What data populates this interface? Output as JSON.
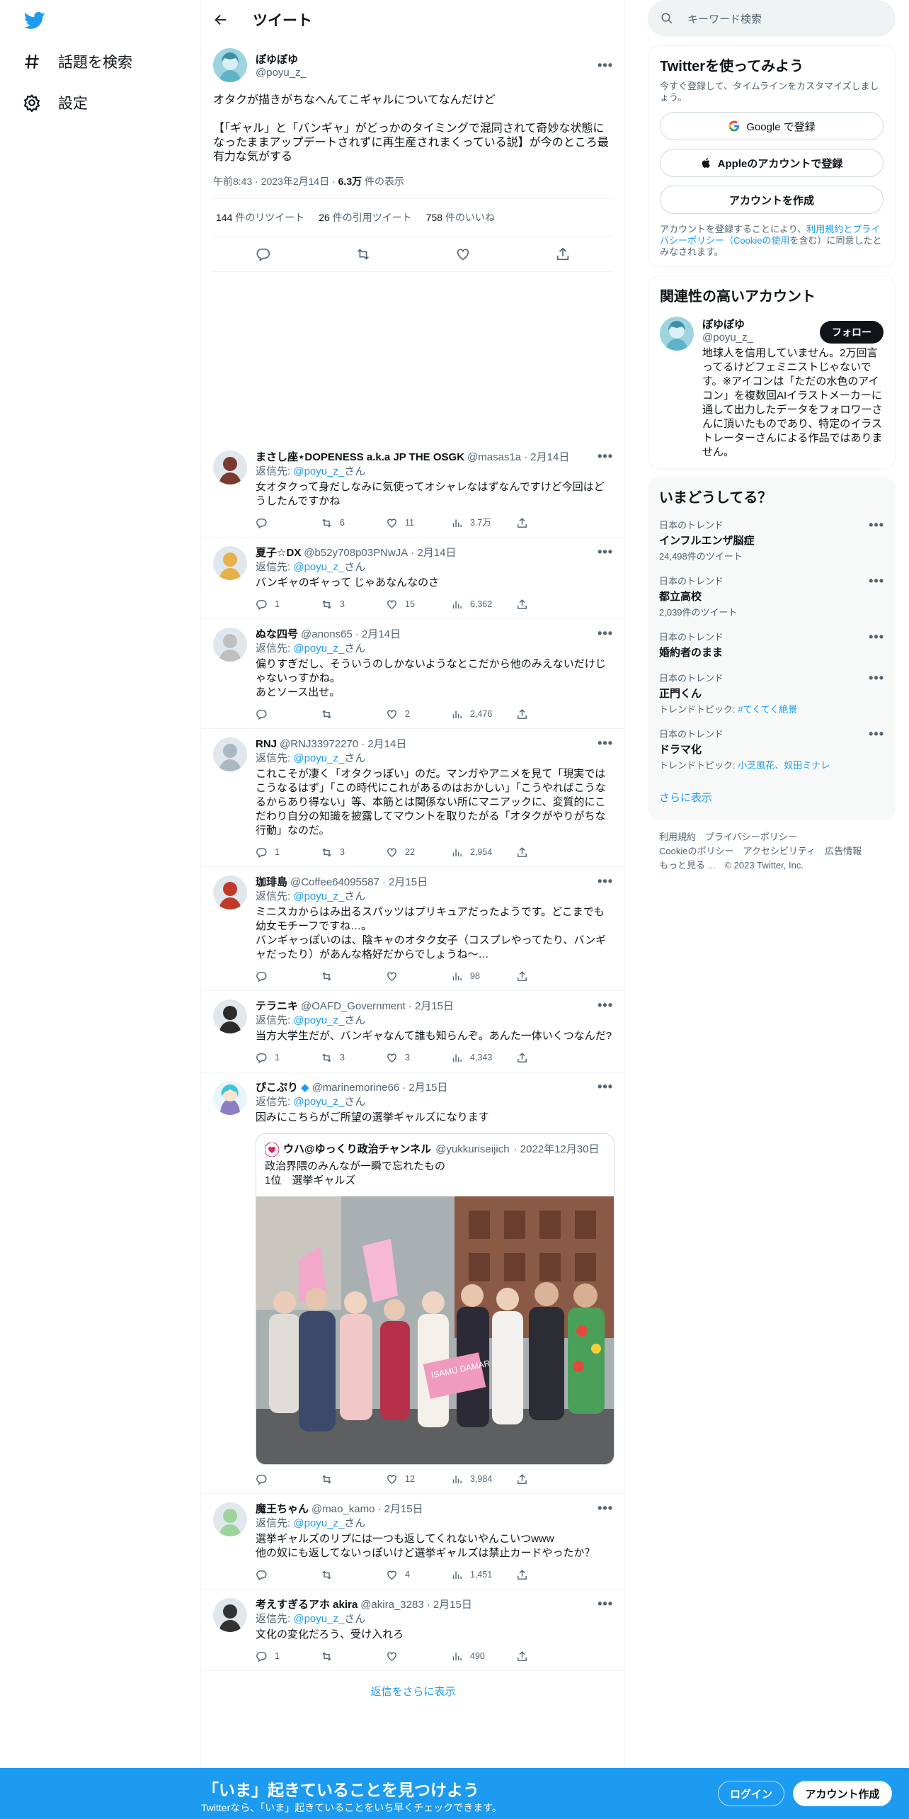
{
  "nav": {
    "explore": "話題を検索",
    "settings": "設定"
  },
  "header": {
    "title": "ツイート"
  },
  "tweet": {
    "name": "ぽゆぽゆ",
    "handle": "@poyu_z_",
    "text": "オタクが描きがちなへんてこギャルについてなんだけど\n\n【「ギャル」と「バンギャ」がどっかのタイミングで混同されて奇妙な状態になったままアップデートされずに再生産されまくっている説】が今のところ最有力な気がする",
    "time": "午前8:43 · 2023年2月14日 · ",
    "views_count": "6.3万",
    "views_label": " 件の表示",
    "retweets": "144",
    "retweets_label": " 件のリツイート",
    "quotes": "26",
    "quotes_label": " 件の引用ツイート",
    "likes": "758",
    "likes_label": " 件のいいね"
  },
  "replies": [
    {
      "name": "まさし座⋆DOPENESS a.k.a JP THE OSGK",
      "handle": "@masas1a",
      "date": "· 2月14日",
      "reply_to": "@poyu_z_",
      "text": "女オタクって身だしなみに気使ってオシャレなはずなんですけど今回はどうしたんですかね",
      "replies": "",
      "retweets": "6",
      "likes": "11",
      "views": "3.7万"
    },
    {
      "name": "夏子☆DX",
      "handle": "@b52y708p03PNwJA",
      "date": "· 2月14日",
      "reply_to": "@poyu_z_",
      "text": "バンギャのギャって じゃあなんなのさ",
      "replies": "1",
      "retweets": "3",
      "likes": "15",
      "views": "6,362"
    },
    {
      "name": "ぬな四号",
      "handle": "@anons65",
      "date": "· 2月14日",
      "reply_to": "@poyu_z_",
      "text": "偏りすぎだし、そういうのしかないようなとこだから他のみえないだけじゃないっすかね。\nあとソース出せ。",
      "replies": "",
      "retweets": "",
      "likes": "2",
      "views": "2,476"
    },
    {
      "name": "RNJ",
      "handle": "@RNJ33972270",
      "date": "· 2月14日",
      "reply_to": "@poyu_z_",
      "text": "これこそが凄く「オタクっぽい」のだ。マンガやアニメを見て「現実ではこうなるはず」「この時代にこれがあるのはおかしい」「こうやればこうなるからあり得ない」等、本筋とは関係ない所にマニアックに、変質的にこだわり自分の知識を披露してマウントを取りたがる「オタクがやりがちな行動」なのだ。",
      "replies": "1",
      "retweets": "3",
      "likes": "22",
      "views": "2,954"
    },
    {
      "name": "珈琲島",
      "handle": "@Coffee64095587",
      "date": "· 2月15日",
      "reply_to": "@poyu_z_",
      "text": "ミニスカからはみ出るスパッツはプリキュアだったようです。どこまでも幼女モチーフですね…。\nバンギャっぽいのは、陰キャのオタク女子（コスプレやってたり、バンギャだったり）があんな格好だからでしょうね〜…",
      "replies": "",
      "retweets": "",
      "likes": "",
      "views": "98"
    },
    {
      "name": "テラニキ",
      "handle": "@OAFD_Government",
      "date": "· 2月15日",
      "reply_to": "@poyu_z_",
      "text": "当方大学生だが、バンギャなんて誰も知らんぞ。あんた一体いくつなんだ?",
      "replies": "1",
      "retweets": "3",
      "likes": "3",
      "views": "4,343"
    }
  ],
  "quote_reply": {
    "name": "ぴこぷり",
    "handle": "@marinemorine66",
    "date": "· 2月15日",
    "reply_to": "@poyu_z_",
    "text": "因みにこちらがご所望の選挙ギャルズになります",
    "quoted": {
      "name": "ウハ@ゆっくり政治チャンネル",
      "handle": "@yukkuriseijich",
      "date": "· 2022年12月30日",
      "text": "政治界隈のみんなが一瞬で忘れたもの\n1位　選挙ギャルズ"
    },
    "photo_sign": "ISAMU\nDAMAR",
    "replies": "",
    "retweets": "",
    "likes": "12",
    "views": "3,984"
  },
  "replies2": [
    {
      "name": "魔王ちゃん",
      "handle": "@mao_kamo",
      "date": "· 2月15日",
      "reply_to": "@poyu_z_",
      "text": "選挙ギャルズのリプには一つも返してくれないやんこいつwww\n他の奴にも返してないっぽいけど選挙ギャルズは禁止カードやったか？",
      "replies": "",
      "retweets": "",
      "likes": "4",
      "views": "1,451"
    },
    {
      "name": "考えすぎるアホ akira",
      "handle": "@akira_3283",
      "date": "· 2月15日",
      "reply_to": "@poyu_z_",
      "text": "文化の変化だろう、受け入れろ",
      "replies": "1",
      "retweets": "",
      "likes": "",
      "views": "490"
    }
  ],
  "reply_prefix": "返信先: ",
  "reply_suffix": "さん",
  "show_more": "返信をさらに表示",
  "search": {
    "placeholder": "キーワード検索"
  },
  "signup": {
    "title": "Twitterを使ってみよう",
    "desc": "今すぐ登録して、タイムラインをカスタマイズしましょう。",
    "google": "Google で登録",
    "apple": "Appleのアカウントで登録",
    "create": "アカウントを作成",
    "terms_pre": "アカウントを登録することにより、",
    "terms_link": "利用規約とプライバシーポリシー（Cookieの使用",
    "terms_post": "を含む）に同意したとみなされます。"
  },
  "related": {
    "title": "関連性の高いアカウント",
    "name": "ぽゆぽゆ",
    "handle": "@poyu_z_",
    "follow": "フォロー",
    "bio": "地球人を信用していません。2万回言ってるけどフェミニストじゃないです。※アイコンは「ただの水色のアイコン」を複数回AIイラストメーカーに通して出力したデータをフォロワーさんに頂いたものであり、特定のイラストレーターさんによる作品ではありません。"
  },
  "trends": {
    "title": "いまどうしてる？",
    "items": [
      {
        "ctx": "日本のトレンド",
        "name": "インフルエンザ脳症",
        "meta": "24,498件のツイート",
        "topic_label": "",
        "topic": ""
      },
      {
        "ctx": "日本のトレンド",
        "name": "都立高校",
        "meta": "2,039件のツイート",
        "topic_label": "",
        "topic": ""
      },
      {
        "ctx": "日本のトレンド",
        "name": "婚約者のまま",
        "meta": "",
        "topic_label": "",
        "topic": ""
      },
      {
        "ctx": "日本のトレンド",
        "name": "正門くん",
        "meta": "",
        "topic_label": "トレンドトピック: ",
        "topic": "#てくてく絶景"
      },
      {
        "ctx": "日本のトレンド",
        "name": "ドラマ化",
        "meta": "",
        "topic_label": "トレンドトピック: ",
        "topic": "小芝風花、奴田ミナレ"
      }
    ],
    "more": "さらに表示"
  },
  "footer": {
    "terms": "利用規約",
    "privacy": "プライバシーポリシー",
    "cookie": "Cookieのポリシー",
    "access": "アクセシビリティ",
    "ads": "広告情報",
    "more": "もっと見る ...",
    "copyright": "© 2023 Twitter, Inc."
  },
  "bottom": {
    "title": "「いま」起きていることを見つけよう",
    "sub": "Twitterなら、「いま」起きていることをいち早くチェックできます。",
    "login": "ログイン",
    "signup": "アカウント作成"
  },
  "colors": {
    "accent": "#1d9bf0",
    "text": "#0f1419",
    "muted": "#536471"
  },
  "icons": [
    "twitter-logo-icon",
    "hashtag-icon",
    "gear-icon",
    "back-arrow-icon",
    "more-icon",
    "reply-icon",
    "retweet-icon",
    "like-icon",
    "views-icon",
    "share-icon",
    "search-icon",
    "google-icon",
    "apple-icon"
  ]
}
